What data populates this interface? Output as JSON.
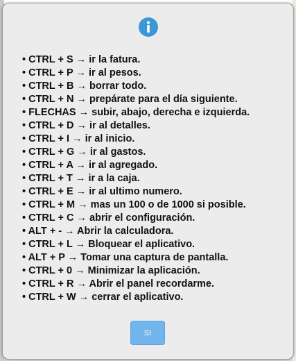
{
  "dialog": {
    "icon": "info-icon",
    "accent_color": "#3a98d6",
    "shortcuts": [
      "• CTRL + S → ir la fatura.",
      "• CTRL + P → ir al pesos.",
      "• CTRL + B → borrar todo.",
      "• CTRL + N → prepárate para el día siguiente.",
      "• FLECHAS → subir, abajo, derecha e izquierda.",
      "• CTRL + D → ir al detalles.",
      "• CTRL + I → ir al inicio.",
      "• CTRL + G → ir al gastos.",
      "• CTRL + A → ir al agregado.",
      "• CTRL + T → ir a la caja.",
      "• CTRL + E → ir al ultimo numero.",
      "• CTRL + M → mas un 100 o de 1000 si posible.",
      "• CTRL + C → abrir el configuración.",
      "• ALT + - → Abrir la calculadora.",
      "• CTRL + L → Bloquear el aplicativo.",
      "• ALT + P → Tomar una captura de pantalla.",
      "• CTRL + 0 → Minimizar la aplicación.",
      "• CTRL + R → Abrir el panel recordarme.",
      "• CTRL + W → cerrar el aplicativo."
    ],
    "confirm_label": "SI",
    "confirm_color": "#72b5ec"
  }
}
